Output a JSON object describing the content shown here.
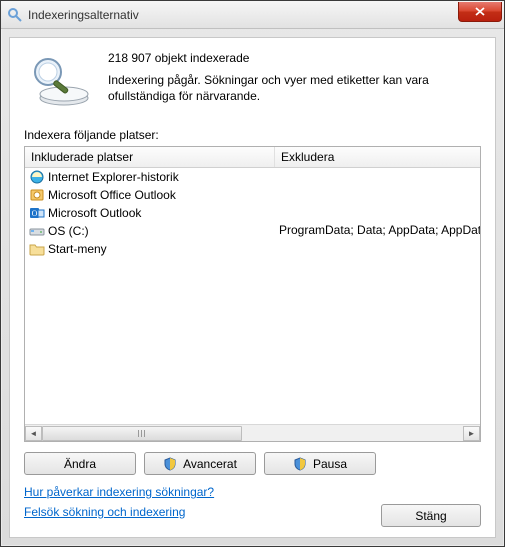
{
  "window": {
    "title": "Indexeringsalternativ"
  },
  "summary": {
    "count_line": "218 907 objekt indexerade",
    "status_line": "Indexering pågår. Sökningar och vyer med etiketter kan vara ofullständiga för närvarande."
  },
  "section_label": "Indexera följande platser:",
  "columns": {
    "included": "Inkluderade platser",
    "exclude": "Exkludera"
  },
  "rows": [
    {
      "icon": "ie",
      "name": "Internet Explorer-historik",
      "exclude": ""
    },
    {
      "icon": "office",
      "name": "Microsoft Office Outlook",
      "exclude": ""
    },
    {
      "icon": "outlook",
      "name": "Microsoft Outlook",
      "exclude": ""
    },
    {
      "icon": "disk",
      "name": "OS (C:)",
      "exclude": "ProgramData; Data; AppData; AppData; AppD"
    },
    {
      "icon": "folder",
      "name": "Start-meny",
      "exclude": ""
    }
  ],
  "buttons": {
    "modify": "Ändra",
    "advanced": "Avancerat",
    "pause": "Pausa",
    "close": "Stäng"
  },
  "links": {
    "help": "Hur påverkar indexering sökningar?",
    "troubleshoot": "Felsök sökning och indexering"
  }
}
